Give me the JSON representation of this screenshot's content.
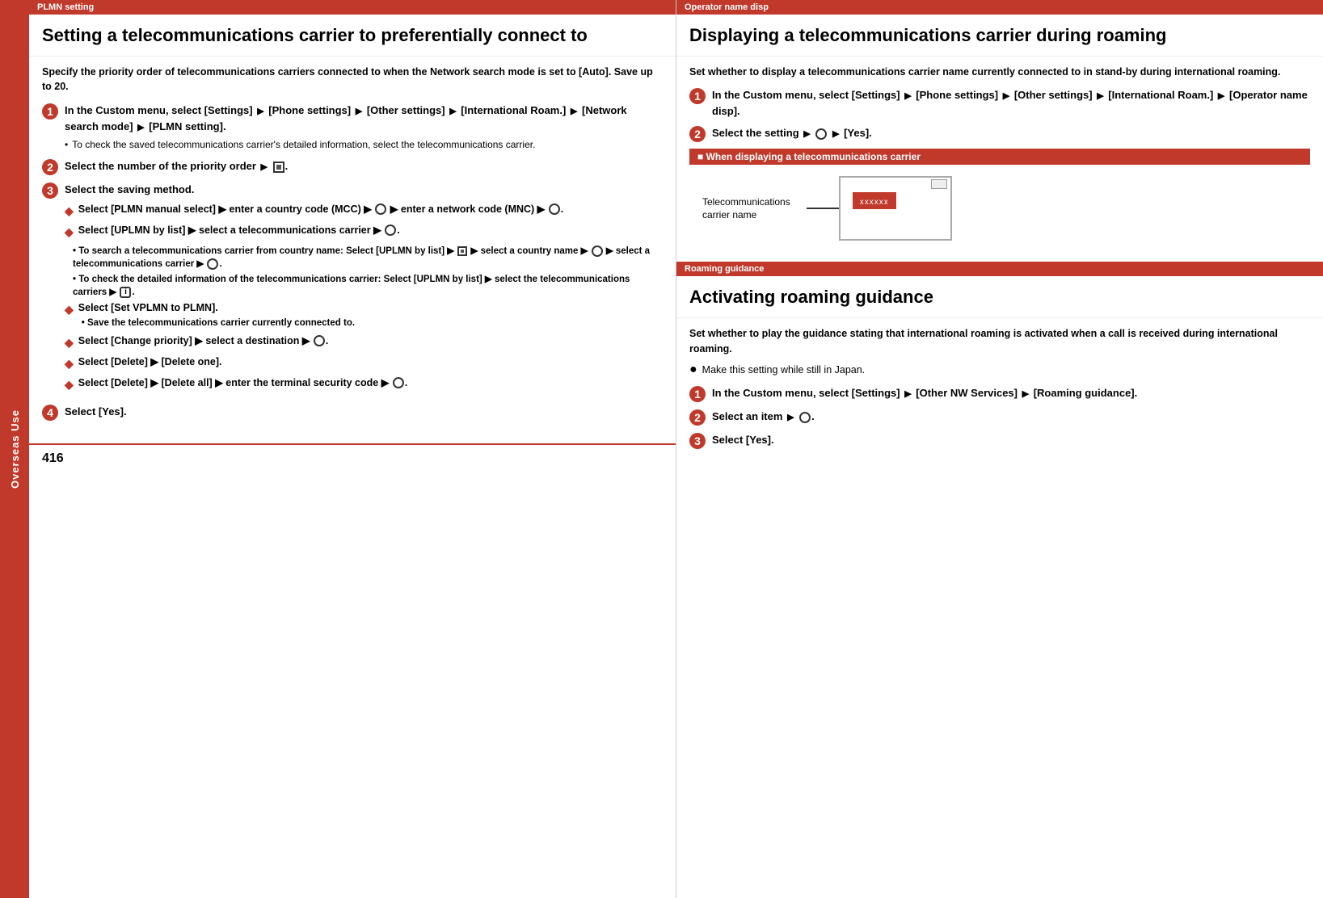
{
  "sidebar": {
    "label": "Overseas Use"
  },
  "left_section": {
    "header": "PLMN setting",
    "title": "Setting a telecommunications carrier to preferentially connect to",
    "intro": "Specify the priority order of telecommunications carriers connected to when the Network search mode is set to [Auto]. Save up to 20.",
    "steps": [
      {
        "number": "1",
        "text": "In the Custom menu, select [Settings] ▶ [Phone settings] ▶ [Other settings] ▶ [International Roam.] ▶ [Network search mode] ▶ [PLMN setting].",
        "note": "To check the saved telecommunications carrier's detailed information, select the telecommunications carrier."
      },
      {
        "number": "2",
        "text": "Select the number of the priority order ▶ ⊙."
      },
      {
        "number": "3",
        "text": "Select the saving method.",
        "sub_steps": [
          {
            "bullet": "◆",
            "text": "Select [PLMN manual select] ▶ enter a country code (MCC) ▶ ⊙ ▶ enter a network code (MNC) ▶ ⊙."
          },
          {
            "bullet": "◆",
            "text": "Select [UPLMN by list] ▶ select a telecommunications carrier ▶ ⊙."
          },
          {
            "sub_note1": "To search a telecommunications carrier from country name: Select [UPLMN by list] ▶ ⊡ ▶ select a country name ▶ ⊙ ▶ select a telecommunications carrier ▶ ⊙."
          },
          {
            "sub_note2": "To check the detailed information of the telecommunications carrier: Select [UPLMN by list] ▶ select the telecommunications carriers ▶ ⓘ."
          },
          {
            "bullet": "◆",
            "text": "Select [Set VPLMN to PLMN].",
            "sub_note": "Save the telecommunications carrier currently connected to."
          },
          {
            "bullet": "◆",
            "text": "Select [Change priority] ▶ select a destination ▶ ⊙."
          },
          {
            "bullet": "◆",
            "text": "Select [Delete] ▶ [Delete one]."
          },
          {
            "bullet": "◆",
            "text": "Select [Delete] ▶ [Delete all] ▶ enter the terminal security code ▶ ⊙."
          }
        ]
      },
      {
        "number": "4",
        "text": "Select [Yes]."
      }
    ]
  },
  "right_section": {
    "header": "Operator name disp",
    "title": "Displaying a telecommunications carrier during roaming",
    "intro": "Set whether to display a telecommunications carrier name currently connected to in stand-by during international roaming.",
    "steps": [
      {
        "number": "1",
        "text": "In the Custom menu, select [Settings] ▶ [Phone settings] ▶ [Other settings] ▶ [International Roam.] ▶ [Operator name disp]."
      },
      {
        "number": "2",
        "text": "Select the setting ▶ ⊙ ▶ [Yes]."
      }
    ],
    "when_displaying": {
      "header": "■ When displaying a telecommunications carrier",
      "diagram_label": "Telecommunications\ncarrier name",
      "phone_text": "xxxxxx"
    },
    "roaming_section": {
      "header": "Roaming guidance",
      "title": "Activating roaming guidance",
      "intro": "Set whether to play the guidance stating that international roaming is activated when a call is received during international roaming.",
      "bullet_note": "Make this setting while still in Japan.",
      "steps": [
        {
          "number": "1",
          "text": "In the Custom menu, select [Settings] ▶ [Other NW Services] ▶ [Roaming guidance]."
        },
        {
          "number": "2",
          "text": "Select an item ▶ ⊙."
        },
        {
          "number": "3",
          "text": "Select [Yes]."
        }
      ]
    }
  },
  "page_number": "416"
}
